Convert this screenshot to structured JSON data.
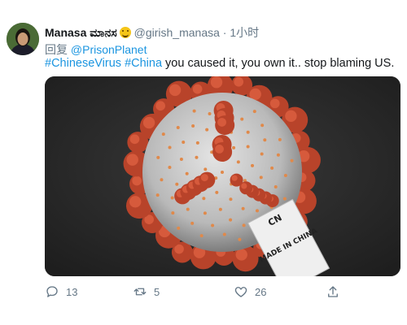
{
  "tweet": {
    "author_name": "Manasa ಮಾನಸ",
    "handle": "@girish_manasa",
    "separator": "·",
    "time": "1小时",
    "reply_prefix": "回复",
    "reply_to": "@PrisonPlanet",
    "hashtag1": "#ChineseVirus",
    "hashtag2": "#China",
    "body_text": " you caused it, you own it.. stop blaming US.",
    "media": {
      "tag_text_top": "CN",
      "tag_text_main": "MADE IN CHINA"
    },
    "actions": {
      "reply_count": "13",
      "retweet_count": "5",
      "like_count": "26"
    },
    "colors": {
      "link": "#1b95e0",
      "muted": "#657786",
      "virus_spike": "#b8432a",
      "virus_body": "#cfcfcf"
    }
  }
}
